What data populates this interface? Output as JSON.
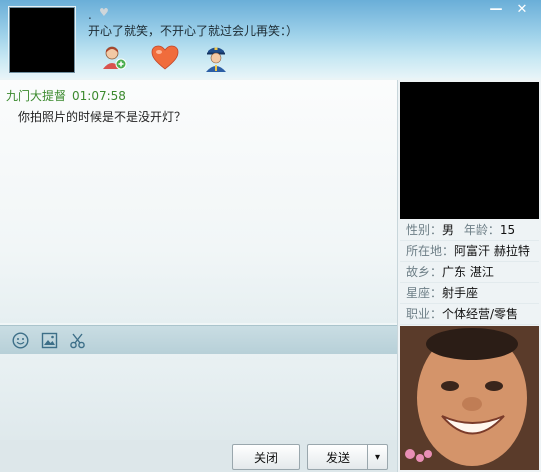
{
  "header": {
    "dot": ".",
    "signature": "开心了就笑，不开心了就过会儿再笑：）",
    "icons": [
      "add-contact-icon",
      "heart-icon",
      "police-icon"
    ]
  },
  "window_controls": {
    "minimize": "—",
    "close": "✕"
  },
  "chat": {
    "messages": [
      {
        "sender": "九门大提督",
        "time": "01:07:58",
        "text": "你拍照片的时候是不是没开灯？"
      }
    ]
  },
  "toolbar": {
    "icons": [
      "emoji-icon",
      "image-icon",
      "scissors-icon"
    ]
  },
  "buttons": {
    "close_label": "关闭",
    "send_label": "发送",
    "send_dropdown": "▾"
  },
  "profile": {
    "gender_label": "性别：",
    "gender": "男",
    "age_label": "年龄：",
    "age": "15",
    "location_label": "所在地：",
    "location": "阿富汗 赫拉特",
    "hometown_label": "故乡：",
    "hometown": "广东 湛江",
    "zodiac_label": "星座：",
    "zodiac": "射手座",
    "job_label": "职业：",
    "job": "个体经营/零售"
  },
  "colors": {
    "sender_name": "#3b8a2e",
    "accent_blue": "#4a9ed0"
  }
}
